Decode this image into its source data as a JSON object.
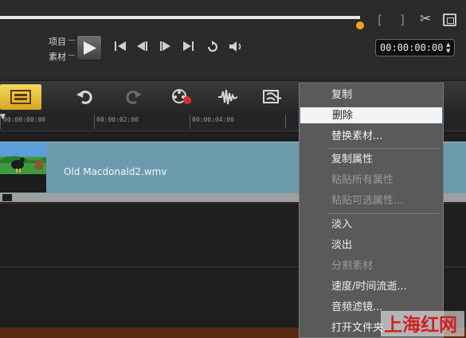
{
  "player": {
    "mode_project_label": "项目",
    "mode_clip_label": "素材",
    "mark_in": "[",
    "mark_out": "]",
    "timecode": "00:00:00:00",
    "scrub_position": 0.77
  },
  "timeline": {
    "ruler_labels": [
      "00:00:00:00",
      "00:00:02:00",
      "00:00:04:00"
    ],
    "clip_name": "Old Macdonald2.wmv"
  },
  "context_menu": {
    "items": [
      {
        "label": "复制",
        "enabled": true
      },
      {
        "label": "删除",
        "enabled": true
      },
      {
        "label": "替换素材...",
        "enabled": true
      },
      {
        "label": "复制属性",
        "enabled": true
      },
      {
        "label": "粘贴所有属性",
        "enabled": false
      },
      {
        "label": "粘贴可选属性...",
        "enabled": false
      },
      {
        "label": "淡入",
        "enabled": true
      },
      {
        "label": "淡出",
        "enabled": true
      },
      {
        "label": "分割素材",
        "enabled": false
      },
      {
        "label": "速度/时间流逝...",
        "enabled": true
      },
      {
        "label": "音频滤镜...",
        "enabled": true
      },
      {
        "label": "打开文件夹...",
        "enabled": true
      }
    ]
  },
  "watermark": {
    "text": "上海红网"
  },
  "colors": {
    "accent": "#f0a020",
    "clip": "#6d9bae",
    "menu_bg": "#5a5a5a",
    "highlight": "#f4f4f4"
  }
}
